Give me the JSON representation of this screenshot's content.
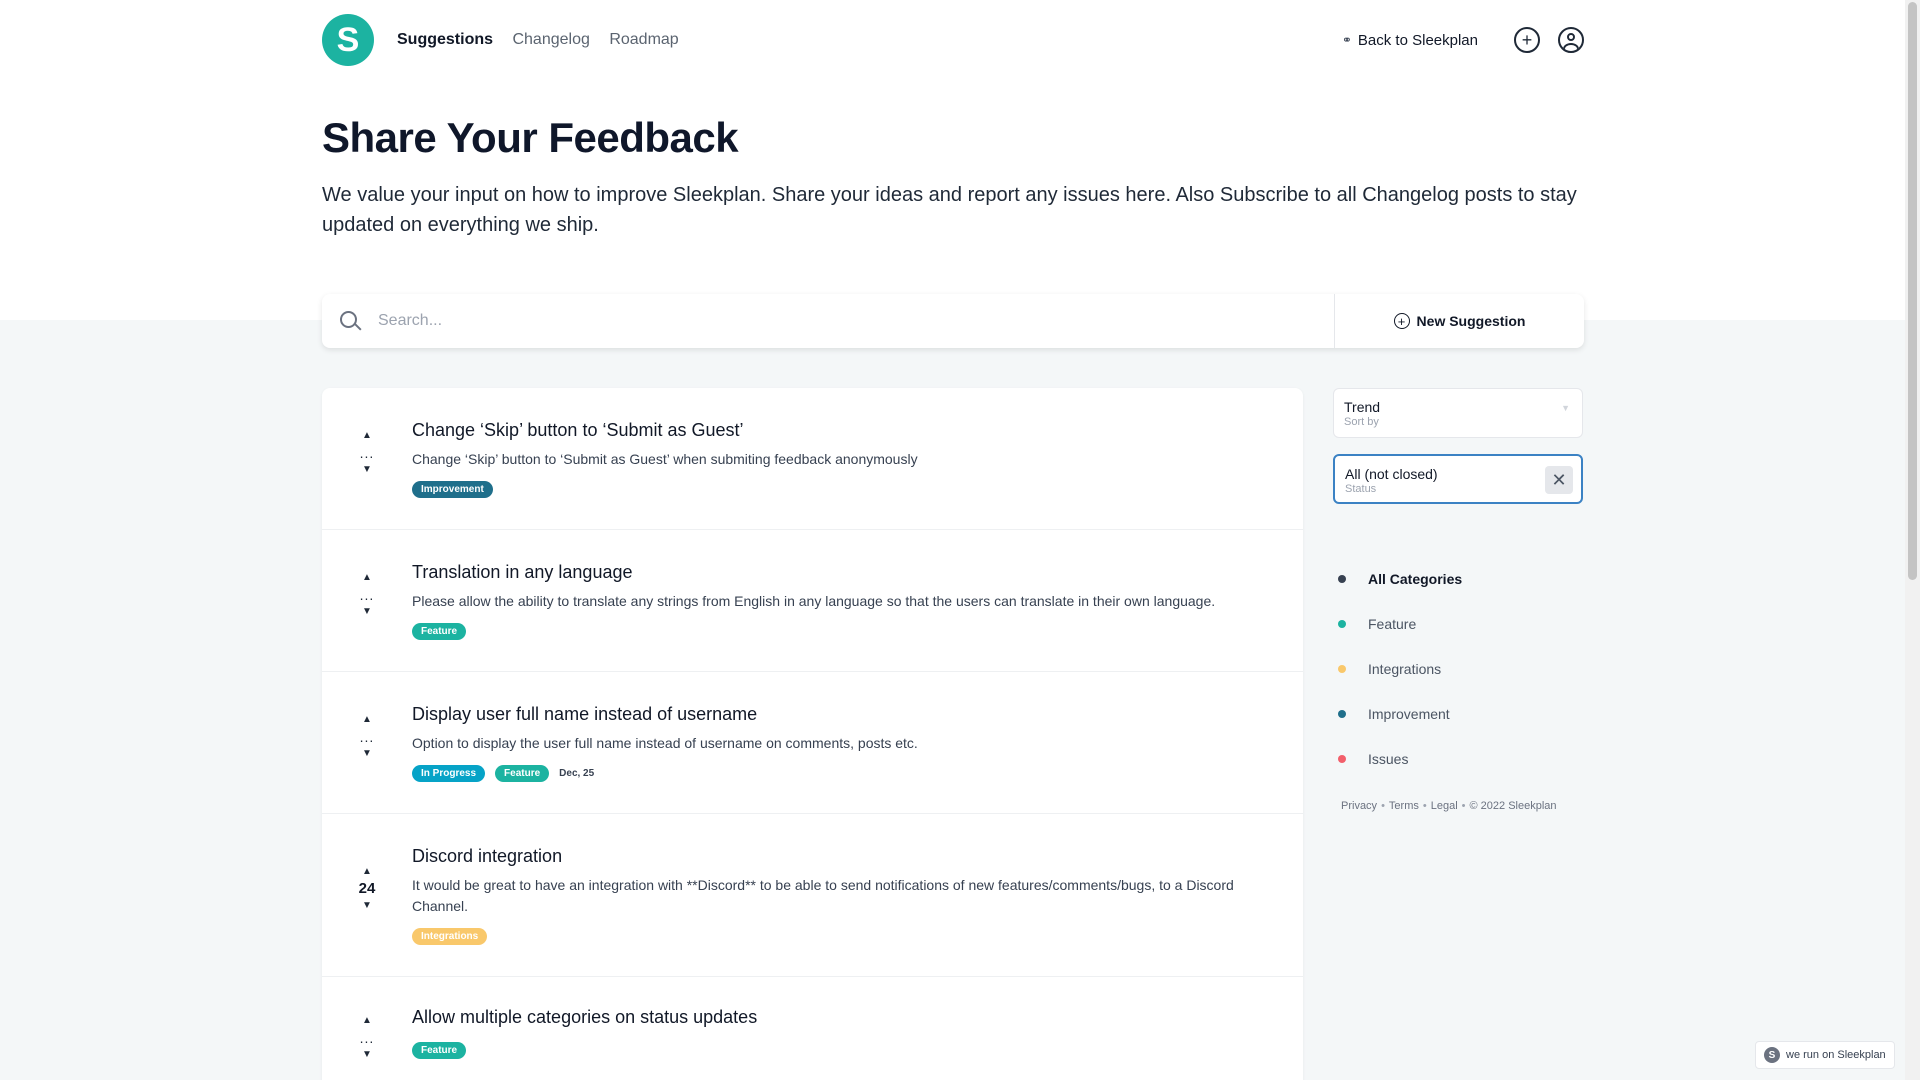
{
  "header": {
    "logo_letter": "S",
    "nav": [
      "Suggestions",
      "Changelog",
      "Roadmap"
    ],
    "back_link": "Back to Sleekplan"
  },
  "hero": {
    "title": "Share Your Feedback",
    "subtitle": "We value your input on how to improve Sleekplan. Share your ideas and report any issues here. Also Subscribe to all Changelog posts to stay updated on everything we ship."
  },
  "search": {
    "placeholder": "Search...",
    "new_button": "New Suggestion"
  },
  "posts": [
    {
      "title": "Change ‘Skip’ button to ‘Submit as Guest’",
      "desc": "Change ‘Skip’ button to ‘Submit as Guest’ when submiting feedback anonymously",
      "votes": "...",
      "tags": [
        {
          "label": "Improvement",
          "color": "#1f6f8b"
        }
      ],
      "date": ""
    },
    {
      "title": "Translation in any language",
      "desc": "Please allow the ability to translate any strings from English in any language so that the users can translate in their own language.",
      "votes": "...",
      "tags": [
        {
          "label": "Feature",
          "color": "#1cb3a1"
        }
      ],
      "date": ""
    },
    {
      "title": "Display user full name instead of username",
      "desc": "Option to display the user full name instead of username on comments, posts etc.",
      "votes": "...",
      "tags": [
        {
          "label": "In Progress",
          "color": "#06a3c7"
        },
        {
          "label": "Feature",
          "color": "#1cb3a1"
        }
      ],
      "date": "Dec, 25"
    },
    {
      "title": "Discord integration",
      "desc": "It would be great to have an integration with **Discord** to be able to send notifications of new features/comments/bugs, to a Discord Channel.",
      "votes": "24",
      "tags": [
        {
          "label": "Integrations",
          "color": "#f9c86b"
        }
      ],
      "date": ""
    },
    {
      "title": "Allow multiple categories on status updates",
      "desc": "",
      "votes": "...",
      "tags": [
        {
          "label": "Feature",
          "color": "#1cb3a1"
        }
      ],
      "date": ""
    }
  ],
  "sidebar": {
    "sort": {
      "value": "Trend",
      "label": "Sort by"
    },
    "status": {
      "value": "All (not closed)",
      "label": "Status"
    },
    "categories": [
      {
        "label": "All Categories",
        "color": "#374151"
      },
      {
        "label": "Feature",
        "color": "#1cb3a1"
      },
      {
        "label": "Integrations",
        "color": "#f9c86b"
      },
      {
        "label": "Improvement",
        "color": "#1f6f8b"
      },
      {
        "label": "Issues",
        "color": "#f25f6b"
      }
    ],
    "footer": [
      "Privacy",
      "Terms",
      "Legal",
      "© 2022 Sleekplan"
    ]
  },
  "badge": "we run on Sleekplan"
}
